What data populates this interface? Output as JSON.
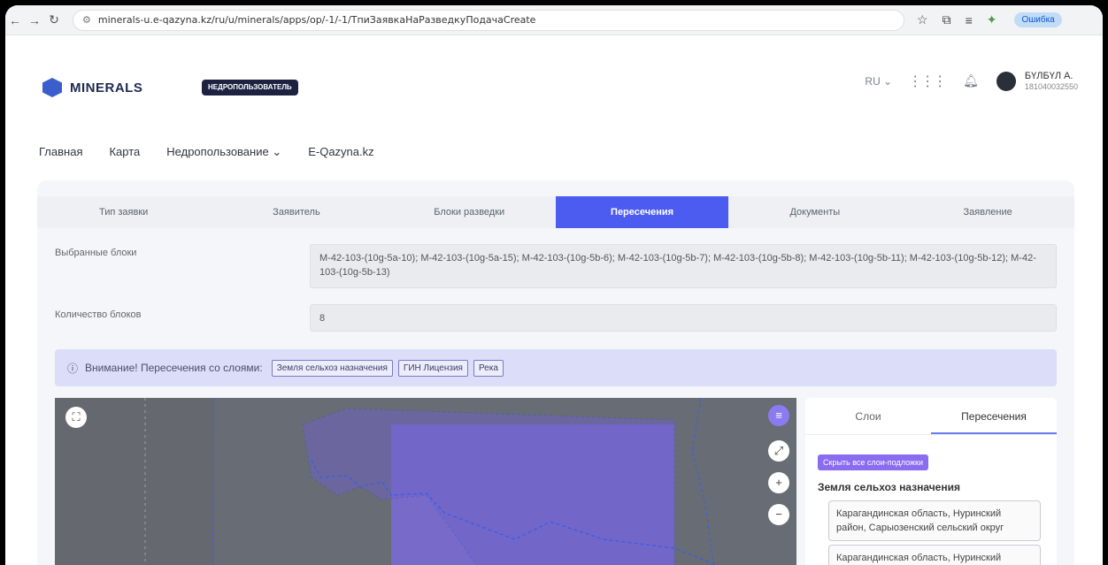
{
  "browser": {
    "url": "minerals-u.e-qazyna.kz/ru/u/minerals/apps/op/-1/-1/ТпиЗаявкаНаРазведкуПодачаCreate",
    "error_label": "Ошибка"
  },
  "header": {
    "logo": "MINERALS",
    "role_badge": "НЕДРОПОЛЬЗОВАТЕЛЬ",
    "lang": "RU ⌄",
    "user_name": "БҮЛБҮЛ А.",
    "user_id": "181040032550"
  },
  "nav": [
    "Главная",
    "Карта",
    "Недропользование ⌄",
    "E-Qazyna.kz"
  ],
  "tabs": [
    {
      "label": "Тип заявки"
    },
    {
      "label": "Заявитель"
    },
    {
      "label": "Блоки разведки"
    },
    {
      "label": "Пересечения"
    },
    {
      "label": "Документы"
    },
    {
      "label": "Заявление"
    }
  ],
  "form": {
    "blocks_label": "Выбранные блоки",
    "blocks_value": "M-42-103-(10g-5a-10); M-42-103-(10g-5a-15); M-42-103-(10g-5b-6); M-42-103-(10g-5b-7); M-42-103-(10g-5b-8); M-42-103-(10g-5b-11); M-42-103-(10g-5b-12); M-42-103-(10g-5b-13)",
    "count_label": "Количество блоков",
    "count_value": "8"
  },
  "alert": {
    "text": "Внимание! Пересечения со слоями:",
    "chips": [
      "Земля сельхоз назначения",
      "ГИН Лицензия",
      "Река"
    ]
  },
  "side_panel": {
    "tab_layers": "Слои",
    "tab_intersections": "Пересечения",
    "hide_button": "Скрыть все слои-подложки",
    "section_title": "Земля сельхоз назначения",
    "items": [
      "Карагандинская область, Нуринский район, Сарыозенский сельский округ",
      "Карагандинская область, Нуринский"
    ]
  },
  "colors": {
    "accent": "#4c5cf0",
    "map_bg": "#6b6f76",
    "overlay": "#7b6ad8"
  }
}
